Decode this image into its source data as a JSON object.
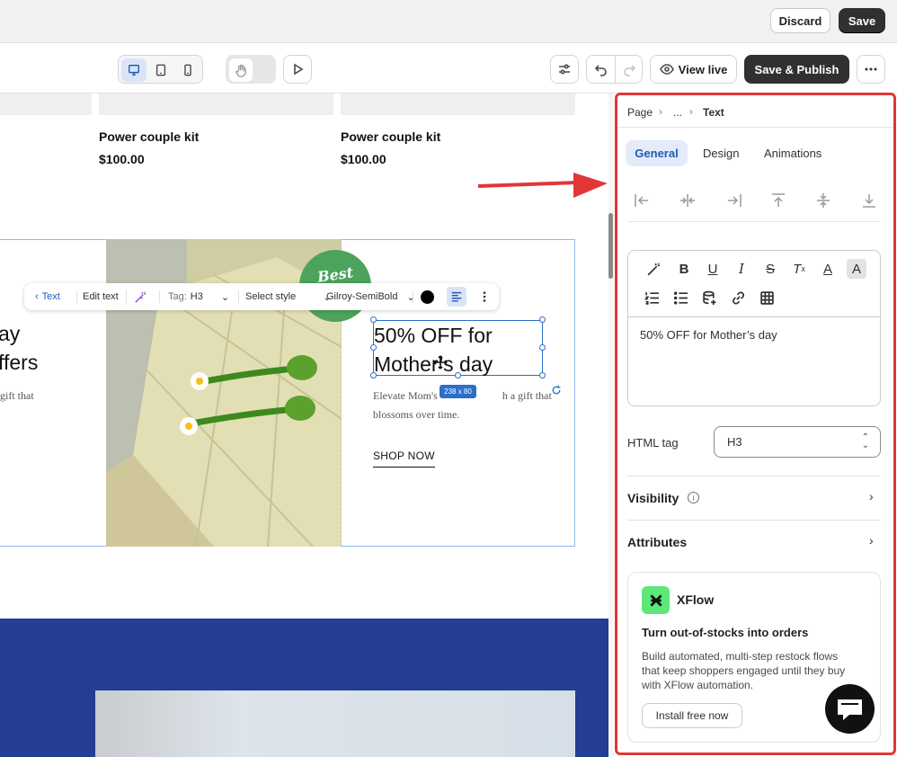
{
  "topbar": {
    "discard_label": "Discard",
    "save_label": "Save"
  },
  "toolbar": {
    "view_live_label": "View live",
    "publish_label": "Save & Publish"
  },
  "canvas": {
    "products": [
      {
        "name": "Power couple kit",
        "price": "$100.00"
      },
      {
        "name": "Power couple kit",
        "price": "$100.00"
      }
    ],
    "left_line1": "ay",
    "left_line2": "ffers",
    "left_desc": "gift that",
    "badge_text": "Best",
    "headline_line1": "50% OFF for",
    "headline_line2": "Mother’s day",
    "size_badge": "238 x 80",
    "desc_line1": "Elevate Mom's",
    "desc_line1b": "h a gift that",
    "desc_line2": "blossoms over time.",
    "shop_now": "SHOP NOW"
  },
  "floating_toolbar": {
    "back_label": "Text",
    "edit_text": "Edit text",
    "tag_label": "Tag:",
    "tag_value": "H3",
    "style_label": "Select style",
    "font_label": "Gilroy-SemiBold",
    "color": "#000000"
  },
  "panel": {
    "breadcrumb": {
      "page": "Page",
      "ellipsis": "...",
      "current": "Text"
    },
    "tabs": {
      "general": "General",
      "design": "Design",
      "animations": "Animations"
    },
    "editor_text": "50% OFF for Mother’s day",
    "html_tag_label": "HTML tag",
    "html_tag_value": "H3",
    "visibility_label": "Visibility",
    "attributes_label": "Attributes",
    "xflow": {
      "name": "XFlow",
      "title": "Turn out-of-stocks into orders",
      "desc1": "Build automated, multi-step restock flows",
      "desc2": "that keep shoppers engaged until they buy",
      "desc3": "with XFlow automation.",
      "install": "Install free now"
    }
  },
  "colors": {
    "accent": "#2c6ecb",
    "highlight_red": "#e03737",
    "section_blue": "#233e92",
    "badge_green": "#4ca35b"
  }
}
